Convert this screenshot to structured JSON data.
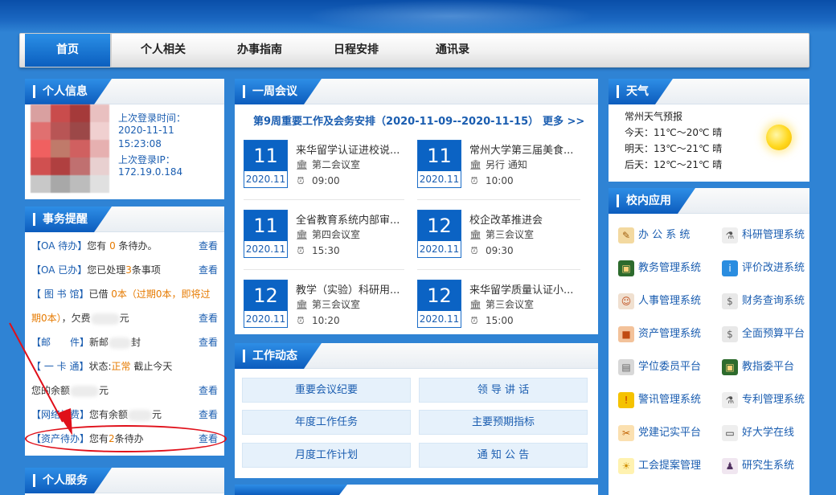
{
  "nav": {
    "items": [
      "首页",
      "个人相关",
      "办事指南",
      "日程安排",
      "通讯录"
    ]
  },
  "personal": {
    "title": "个人信息",
    "last_login_label": "上次登录时间：",
    "last_login_date": "2020-11-11",
    "last_login_time": "15:23:08",
    "last_ip_label": "上次登录IP：",
    "last_ip": "172.19.0.184"
  },
  "reminders": {
    "title": "事务提醒",
    "view": "查看",
    "oa_todo": {
      "tag": "【OA 待办】",
      "pre": "您有 ",
      "count": "0",
      "post": " 条待办。"
    },
    "oa_done": {
      "tag": "【OA 已办】",
      "pre": "您已处理",
      "count": "3",
      "post": "条事项"
    },
    "library": {
      "tag": "【 图 书 馆】",
      "pre": "已借 ",
      "borrowed": "0本（过期0本，即将过",
      "line2": "期0本）",
      "fine": "，欠费",
      "unit": "元"
    },
    "mail": {
      "tag": "【邮　　件】",
      "pre": "新邮",
      "post": "封"
    },
    "card": {
      "tag": "【 一 卡 通】",
      "pre": "状态:",
      "status": "正常",
      "post": " 截止今天",
      "line2a": "您的余额",
      "line2b": "元"
    },
    "network": {
      "tag": "【网络计费】",
      "pre": "您有余额",
      "post": "元"
    },
    "asset": {
      "tag": "【资产待办】",
      "pre": "您有",
      "count": "2",
      "post": "条待办"
    }
  },
  "services": {
    "title": "个人服务"
  },
  "meetings": {
    "title": "一周会议",
    "headline": "第9周重要工作及会务安排（2020-11-09--2020-11-15）",
    "more": "更多 >>",
    "items": [
      {
        "day": "11",
        "month": "2020.11",
        "title": "来华留学认证进校说...",
        "place": "第二会议室",
        "time": "09:00"
      },
      {
        "day": "11",
        "month": "2020.11",
        "title": "常州大学第三届美食...",
        "place": "另行 通知",
        "time": "10:00"
      },
      {
        "day": "11",
        "month": "2020.11",
        "title": "全省教育系统内部审...",
        "place": "第四会议室",
        "time": "15:30"
      },
      {
        "day": "12",
        "month": "2020.11",
        "title": "校企改革推进会",
        "place": "第三会议室",
        "time": "09:30"
      },
      {
        "day": "12",
        "month": "2020.11",
        "title": "教学（实验）科研用...",
        "place": "第三会议室",
        "time": "10:20"
      },
      {
        "day": "12",
        "month": "2020.11",
        "title": "来华留学质量认证小...",
        "place": "第三会议室",
        "time": "15:00"
      }
    ]
  },
  "work": {
    "title": "工作动态",
    "buttons": [
      "重要会议纪要",
      "领 导 讲 话",
      "年度工作任务",
      "主要预期指标",
      "月度工作计划",
      "通 知 公 告"
    ]
  },
  "weather": {
    "title": "天气",
    "city": "常州天气预报",
    "today": "今天：11℃～20℃ 晴",
    "tomorrow": "明天：13℃～21℃ 晴",
    "after": "后天：12℃～21℃ 晴"
  },
  "apps": {
    "title": "校内应用",
    "items": [
      {
        "label": "办 公 系 统",
        "icon": "pencil-icon"
      },
      {
        "label": "科研管理系统",
        "icon": "microscope-icon"
      },
      {
        "label": "教务管理系统",
        "icon": "blackboard-icon"
      },
      {
        "label": "评价改进系统",
        "icon": "info-icon"
      },
      {
        "label": "人事管理系统",
        "icon": "people-icon"
      },
      {
        "label": "财务查询系统",
        "icon": "money-bag-icon"
      },
      {
        "label": "资产管理系统",
        "icon": "box-icon"
      },
      {
        "label": "全面预算平台",
        "icon": "money-bag-icon"
      },
      {
        "label": "学位委员平台",
        "icon": "server-icon"
      },
      {
        "label": "教指委平台",
        "icon": "blackboard-icon"
      },
      {
        "label": "警讯管理系统",
        "icon": "shield-icon"
      },
      {
        "label": "专利管理系统",
        "icon": "microscope-icon"
      },
      {
        "label": "党建记实平台",
        "icon": "tools-icon"
      },
      {
        "label": "好大学在线",
        "icon": "monitor-icon"
      },
      {
        "label": "工会提案管理",
        "icon": "bulb-icon"
      },
      {
        "label": "研究生系统",
        "icon": "graduate-icon"
      }
    ]
  },
  "colors": {
    "primary": "#0b63c4",
    "accent": "#e67a00",
    "annotation": "#e0101a"
  }
}
